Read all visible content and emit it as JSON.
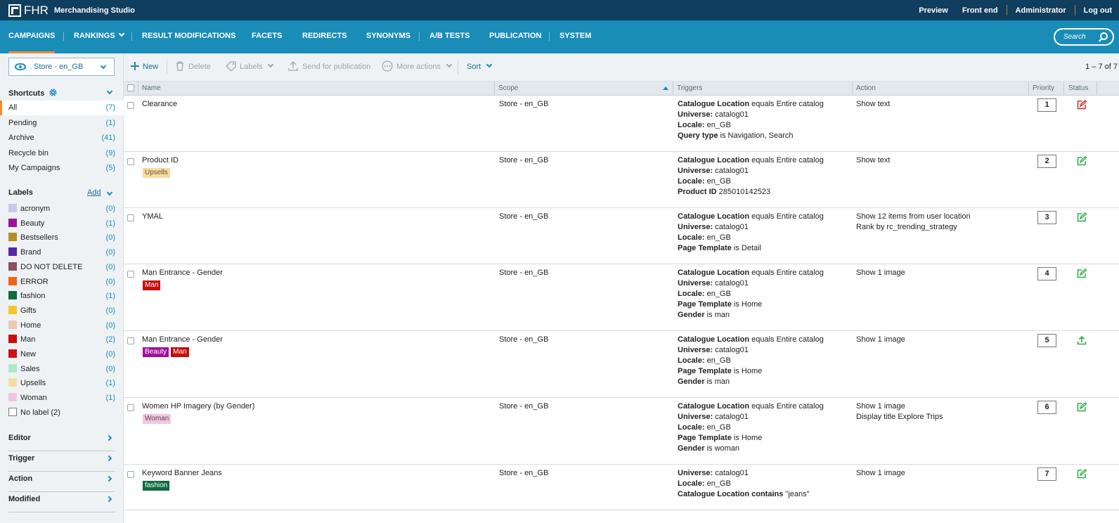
{
  "app": {
    "brand": "FHR",
    "title": "Merchandising Studio"
  },
  "toplinks": [
    "Preview",
    "Front end",
    "Administrator",
    "Log out"
  ],
  "nav": {
    "items": [
      "CAMPAIGNS",
      "RANKINGS",
      "RESULT MODIFICATIONS",
      "FACETS",
      "REDIRECTS",
      "SYNONYMS",
      "A/B TESTS",
      "PUBLICATION",
      "SYSTEM"
    ],
    "active": "CAMPAIGNS",
    "search_placeholder": "Search"
  },
  "sidebar": {
    "store": "Store - en_GB",
    "shortcuts_title": "Shortcuts",
    "shortcuts": [
      {
        "label": "All",
        "count": "(7)"
      },
      {
        "label": "Pending",
        "count": "(1)"
      },
      {
        "label": "Archive",
        "count": "(41)"
      },
      {
        "label": "Recycle bin",
        "count": "(9)"
      },
      {
        "label": "My Campaigns",
        "count": "(5)"
      }
    ],
    "labels_title": "Labels",
    "labels_add": "Add",
    "labels": [
      {
        "label": "acronym",
        "count": "(0)",
        "color": "#c9c8e8"
      },
      {
        "label": "Beauty",
        "count": "(1)",
        "color": "#a0109e"
      },
      {
        "label": "Bestsellers",
        "count": "(0)",
        "color": "#b38e25"
      },
      {
        "label": "Brand",
        "count": "(0)",
        "color": "#5128a8"
      },
      {
        "label": "DO NOT DELETE",
        "count": "(0)",
        "color": "#8e4d61"
      },
      {
        "label": "ERROR",
        "count": "(0)",
        "color": "#f26516"
      },
      {
        "label": "fashion",
        "count": "(1)",
        "color": "#0f6a3f"
      },
      {
        "label": "Gifts",
        "count": "(0)",
        "color": "#f8c52c"
      },
      {
        "label": "Home",
        "count": "(0)",
        "color": "#eac9b6"
      },
      {
        "label": "Man",
        "count": "(2)",
        "color": "#c70d0d"
      },
      {
        "label": "New",
        "count": "(0)",
        "color": "#d50e15"
      },
      {
        "label": "Sales",
        "count": "(0)",
        "color": "#b0e8c9"
      },
      {
        "label": "Upsells",
        "count": "(1)",
        "color": "#f6dca2"
      },
      {
        "label": "Woman",
        "count": "(1)",
        "color": "#efc8e0"
      }
    ],
    "no_label": "No label (2)",
    "accordions": [
      "Editor",
      "Trigger",
      "Action",
      "Modified"
    ]
  },
  "toolbar": {
    "new": "New",
    "delete": "Delete",
    "labels": "Labels",
    "send": "Send for publication",
    "more": "More actions",
    "sort": "Sort",
    "pager": "1 – 7 of 7"
  },
  "columns": {
    "name": "Name",
    "scope": "Scope",
    "triggers": "Triggers",
    "action": "Action",
    "priority": "Priority",
    "status": "Status"
  },
  "rows": [
    {
      "name": "Clearance",
      "tags": [],
      "scope": "Store - en_GB",
      "triggers": [
        [
          "Catalogue Location",
          " equals Entire catalog"
        ],
        [
          "Universe:",
          " catalog01"
        ],
        [
          "Locale:",
          " en_GB"
        ],
        [
          "Query type",
          " is Navigation, Search"
        ]
      ],
      "action": [
        "Show text"
      ],
      "priority": "1",
      "status": "edit-red"
    },
    {
      "name": "Product ID",
      "tags": [
        {
          "text": "Upsells",
          "bg": "#f6dca2",
          "fg": "#6a5222"
        }
      ],
      "scope": "Store - en_GB",
      "triggers": [
        [
          "Catalogue Location",
          " equals Entire catalog"
        ],
        [
          "Universe:",
          " catalog01"
        ],
        [
          "Locale:",
          " en_GB"
        ],
        [
          "Product ID",
          " 285010142523"
        ]
      ],
      "action": [
        "Show text"
      ],
      "priority": "2",
      "status": "edit-green"
    },
    {
      "name": "YMAL",
      "tags": [],
      "scope": "Store - en_GB",
      "triggers": [
        [
          "Catalogue Location",
          " equals Entire catalog"
        ],
        [
          "Universe:",
          " catalog01"
        ],
        [
          "Locale:",
          " en_GB"
        ],
        [
          "Page Template",
          " is Detail"
        ]
      ],
      "action": [
        "Show 12 items from user location",
        "Rank by rc_trending_strategy"
      ],
      "priority": "3",
      "status": "edit-green"
    },
    {
      "name": "Man Entrance - Gender",
      "tags": [
        {
          "text": "Man",
          "bg": "#c70d0d",
          "fg": "#ffffff"
        }
      ],
      "scope": "Store - en_GB",
      "triggers": [
        [
          "Catalogue Location",
          " equals Entire catalog"
        ],
        [
          "Universe:",
          " catalog01"
        ],
        [
          "Locale:",
          " en_GB"
        ],
        [
          "Page Template",
          " is Home"
        ],
        [
          "Gender",
          " is man"
        ]
      ],
      "action": [
        "Show 1 image"
      ],
      "priority": "4",
      "status": "edit-green"
    },
    {
      "name": "Man Entrance - Gender",
      "tags": [
        {
          "text": "Beauty",
          "bg": "#a0109e",
          "fg": "#ffffff"
        },
        {
          "text": "Man",
          "bg": "#c70d0d",
          "fg": "#ffffff"
        }
      ],
      "scope": "Store - en_GB",
      "triggers": [
        [
          "Catalogue Location",
          " equals Entire catalog"
        ],
        [
          "Universe:",
          " catalog01"
        ],
        [
          "Locale:",
          " en_GB"
        ],
        [
          "Page Template",
          " is Home"
        ],
        [
          "Gender",
          " is man"
        ]
      ],
      "action": [
        "Show 1 image"
      ],
      "priority": "5",
      "status": "upload-green"
    },
    {
      "name": "Women HP Imagery (by Gender)",
      "tags": [
        {
          "text": "Woman",
          "bg": "#efc8e0",
          "fg": "#6a3e58"
        }
      ],
      "scope": "Store - en_GB",
      "triggers": [
        [
          "Catalogue Location",
          " equals Entire catalog"
        ],
        [
          "Universe:",
          " catalog01"
        ],
        [
          "Locale:",
          " en_GB"
        ],
        [
          "Page Template",
          " is Home"
        ],
        [
          "Gender",
          " is woman"
        ]
      ],
      "action": [
        "Show 1 image",
        "Display title Explore Trips"
      ],
      "priority": "6",
      "status": "edit-green"
    },
    {
      "name": "Keyword Banner Jeans",
      "tags": [
        {
          "text": "fashion",
          "bg": "#0f6a3f",
          "fg": "#ffffff"
        }
      ],
      "scope": "Store - en_GB",
      "triggers": [
        [
          "Universe:",
          " catalog01"
        ],
        [
          "Locale:",
          " en_GB"
        ],
        [
          "Catalogue Location contains",
          " \"jeans\""
        ]
      ],
      "action": [
        "Show 1 image"
      ],
      "priority": "7",
      "status": "edit-green"
    }
  ]
}
